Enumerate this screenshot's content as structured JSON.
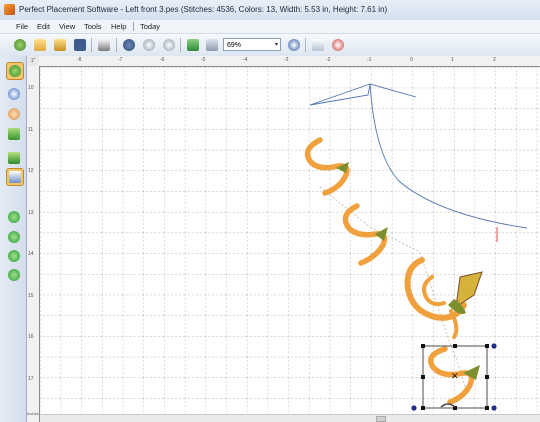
{
  "window": {
    "title": "Perfect Placement Software - Left front 3.pes (Stitches: 4536, Colors: 13, Width: 5.53 in, Height: 7.61 in)"
  },
  "menu": {
    "items": [
      "File",
      "Edit",
      "View",
      "Tools",
      "Help"
    ],
    "today": "Today"
  },
  "toolbar": {
    "zoom_value": "69%",
    "buttons": [
      "new-design-icon",
      "open-icon",
      "open-recent-icon",
      "save-icon",
      "print-icon",
      "cut-icon",
      "copy-icon",
      "paste-icon",
      "import-icon",
      "export-icon",
      "zoom-options-icon",
      "clipboard-icon",
      "hoop-icon"
    ]
  },
  "left_toolbar": {
    "buttons": [
      "select-tool-icon",
      "zoom-tool-icon",
      "hand-pan-icon",
      "ruler-icon",
      "stitch-count-icon",
      "hoop-layout-icon",
      "move-right-icon",
      "move-down-icon",
      "rotate-left-icon",
      "rotate-right-icon"
    ]
  },
  "rulers": {
    "corner": "1\"",
    "horizontal": [
      "-8",
      "-7",
      "-6",
      "-5",
      "-4",
      "-3",
      "-2",
      "-1",
      "0",
      "1",
      "2"
    ],
    "vertical": [
      "10",
      "11",
      "12",
      "13",
      "14",
      "15",
      "16",
      "17"
    ],
    "bottom_corner": "Inches"
  },
  "colors": {
    "motif_orange": "#f0a03c",
    "motif_outline": "#d7762a",
    "leaf_gold": "#d5b23b",
    "leaf_green": "#7d8f2d",
    "guide_blue": "#4f74b2",
    "grid": "#9a9a9a"
  }
}
